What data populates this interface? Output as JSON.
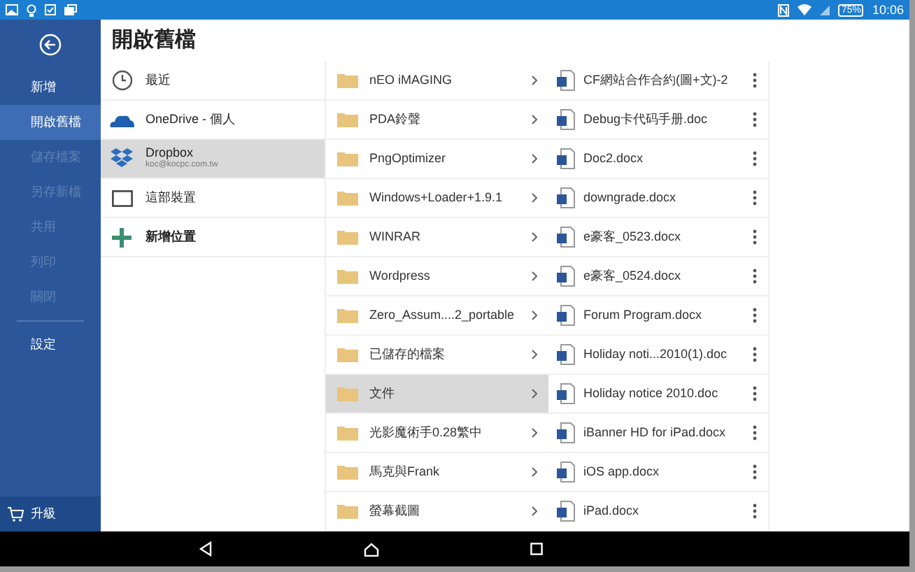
{
  "status_bar": {
    "battery": "75%",
    "time": "10:06"
  },
  "sidebar": {
    "items": [
      {
        "label": "新增",
        "selected": false,
        "disabled": false
      },
      {
        "label": "開啟舊檔",
        "selected": true,
        "disabled": false
      },
      {
        "label": "儲存檔案",
        "selected": false,
        "disabled": true
      },
      {
        "label": "另存新檔",
        "selected": false,
        "disabled": true
      },
      {
        "label": "共用",
        "selected": false,
        "disabled": true
      },
      {
        "label": "列印",
        "selected": false,
        "disabled": true
      },
      {
        "label": "關閉",
        "selected": false,
        "disabled": true
      },
      {
        "label": "設定",
        "selected": false,
        "disabled": false
      }
    ],
    "upgrade": "升級"
  },
  "title": "開啟舊檔",
  "places": [
    {
      "kind": "recent",
      "label": "最近",
      "selected": false
    },
    {
      "kind": "onedrive",
      "label": "OneDrive - 個人",
      "selected": false
    },
    {
      "kind": "dropbox",
      "label": "Dropbox",
      "account": "koc@kocpc.com.tw",
      "selected": true
    },
    {
      "kind": "device",
      "label": "這部裝置",
      "selected": false
    },
    {
      "kind": "add",
      "label": "新增位置",
      "selected": false
    }
  ],
  "folders": [
    {
      "name": "nEO iMAGING",
      "selected": false
    },
    {
      "name": "PDA鈴聲",
      "selected": false
    },
    {
      "name": "PngOptimizer",
      "selected": false
    },
    {
      "name": "Windows+Loader+1.9.1",
      "selected": false
    },
    {
      "name": "WINRAR",
      "selected": false
    },
    {
      "name": "Wordpress",
      "selected": false
    },
    {
      "name": "Zero_Assum....2_portable",
      "selected": false
    },
    {
      "name": "已儲存的檔案",
      "selected": false
    },
    {
      "name": "文件",
      "selected": true
    },
    {
      "name": "光影魔術手0.28繁中",
      "selected": false
    },
    {
      "name": "馬克與Frank",
      "selected": false
    },
    {
      "name": "螢幕截圖",
      "selected": false
    }
  ],
  "files": [
    "CF網站合作合約(圖+文)-2",
    "Debug卡代码手册.doc",
    "Doc2.docx",
    "downgrade.docx",
    "e豪客_0523.docx",
    "e豪客_0524.docx",
    "Forum Program.docx",
    "Holiday noti...2010(1).doc",
    "Holiday notice 2010.doc",
    "iBanner HD for iPad.docx",
    "iOS app.docx",
    "iPad.docx"
  ]
}
